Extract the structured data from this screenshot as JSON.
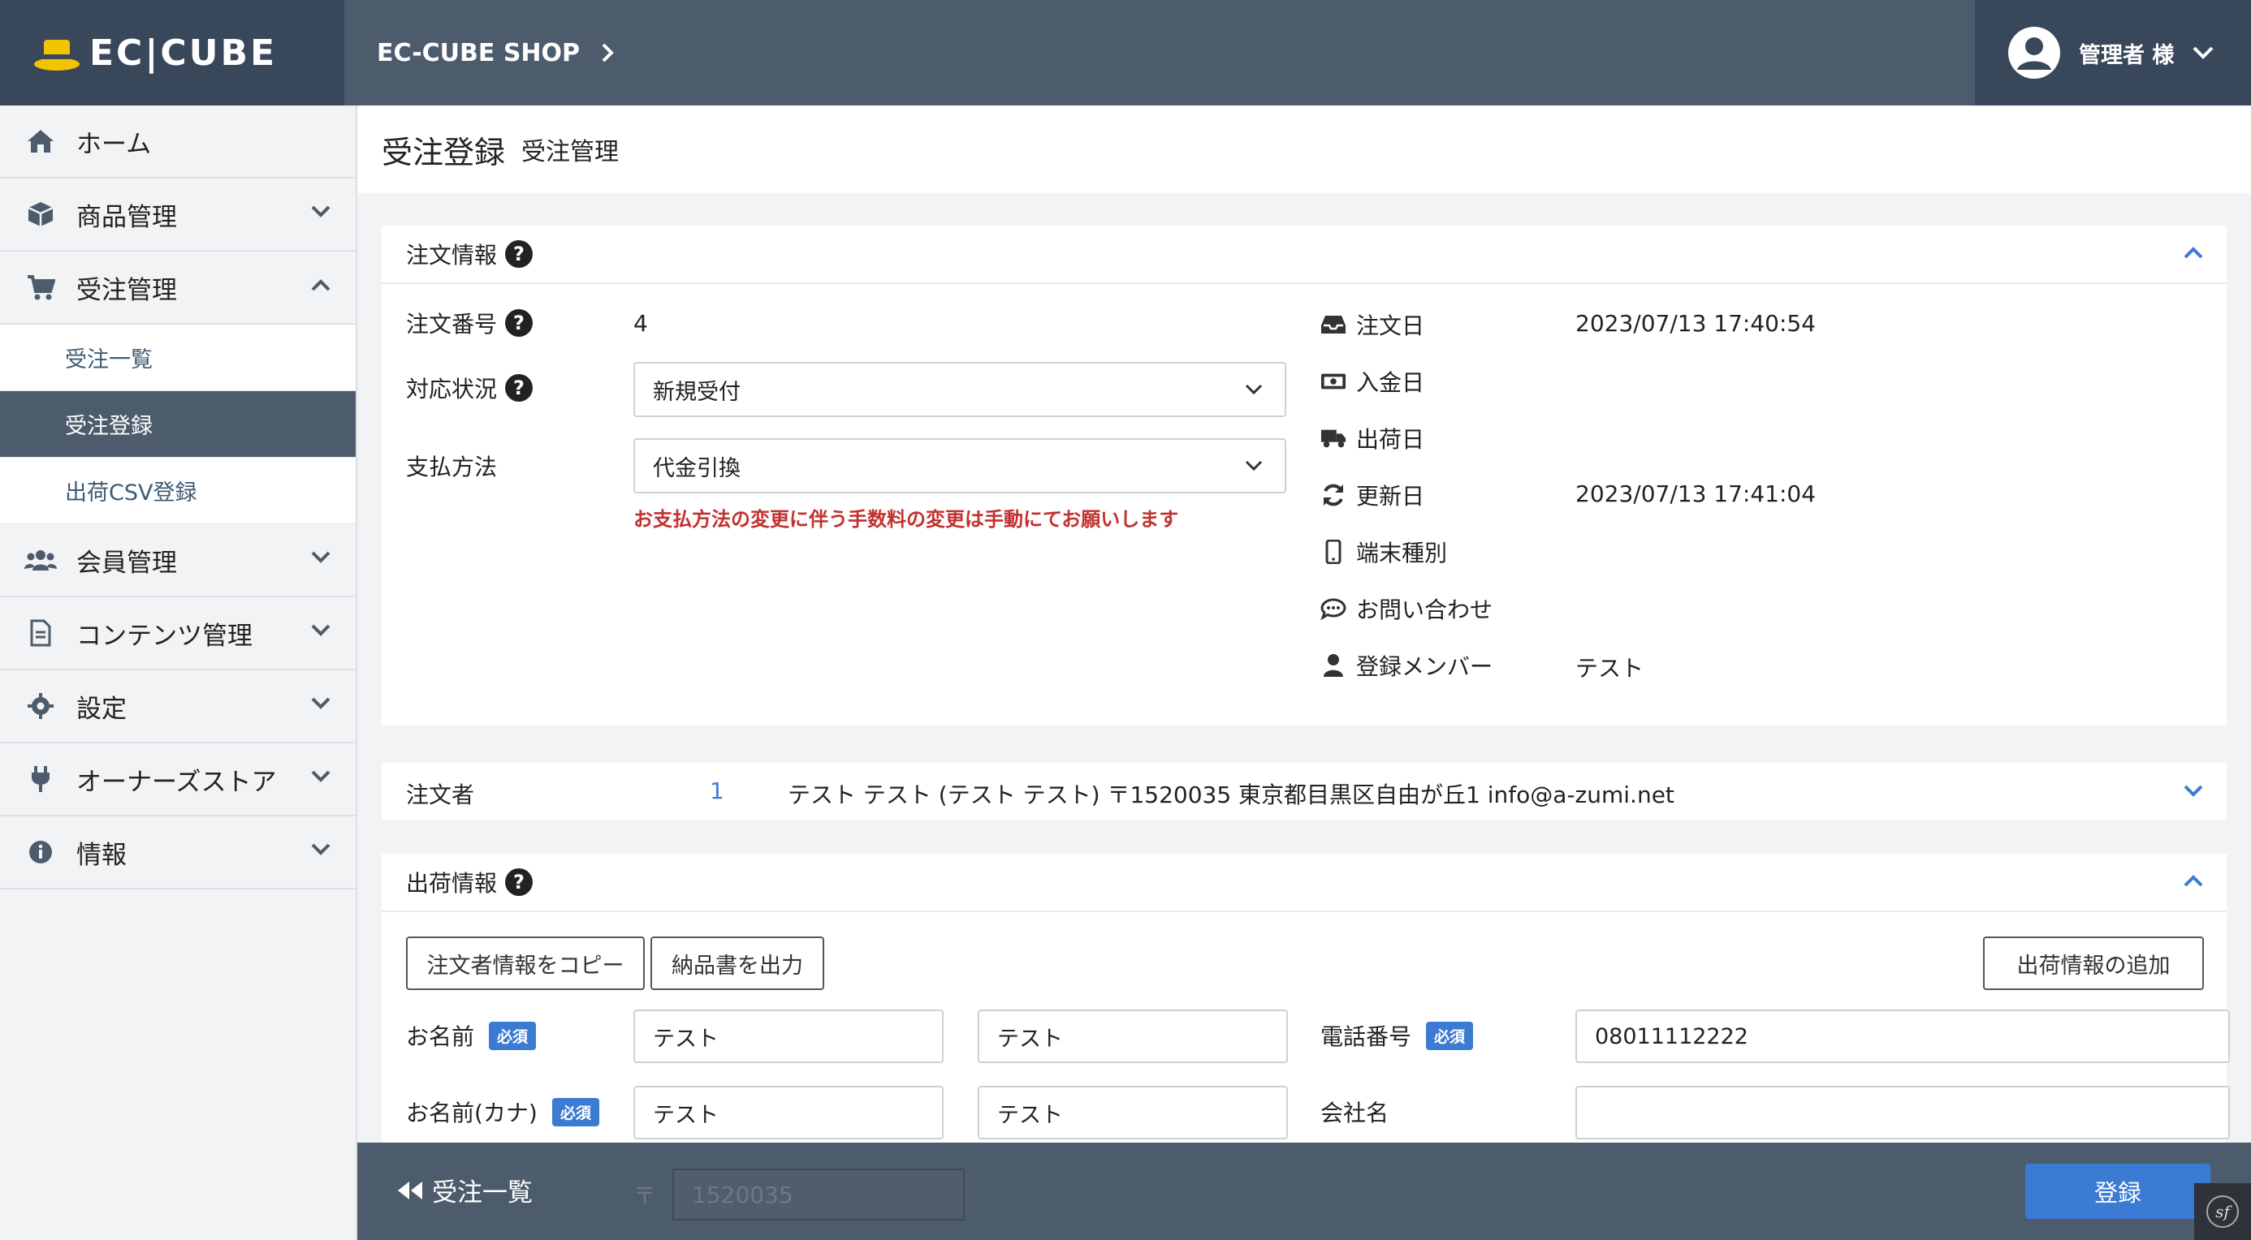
{
  "header": {
    "brand": "EC|CUBE",
    "shop_name": "EC-CUBE SHOP",
    "user_label": "管理者 様"
  },
  "sidebar": {
    "items": [
      {
        "label": "ホーム",
        "icon": "home-icon"
      },
      {
        "label": "商品管理",
        "icon": "box-icon"
      },
      {
        "label": "受注管理",
        "icon": "cart-icon"
      },
      {
        "label": "会員管理",
        "icon": "users-icon"
      },
      {
        "label": "コンテンツ管理",
        "icon": "file-icon"
      },
      {
        "label": "設定",
        "icon": "gear-icon"
      },
      {
        "label": "オーナーズストア",
        "icon": "plug-icon"
      },
      {
        "label": "情報",
        "icon": "info-icon"
      }
    ],
    "sub_items": [
      "受注一覧",
      "受注登録",
      "出荷CSV登録"
    ]
  },
  "page": {
    "title": "受注登録",
    "subtitle": "受注管理"
  },
  "order_info": {
    "heading": "注文情報",
    "order_no_label": "注文番号",
    "order_no": "4",
    "status_label": "対応状況",
    "status_value": "新規受付",
    "payment_label": "支払方法",
    "payment_value": "代金引換",
    "payment_warning": "お支払方法の変更に伴う手数料の変更は手動にてお願いします",
    "order_date_label": "注文日",
    "order_date": "2023/07/13 17:40:54",
    "payment_date_label": "入金日",
    "shipping_date_label": "出荷日",
    "update_date_label": "更新日",
    "update_date": "2023/07/13 17:41:04",
    "device_label": "端末種別",
    "inquiry_label": "お問い合わせ",
    "member_label": "登録メンバー",
    "member_value": "テスト"
  },
  "customer": {
    "label": "注文者",
    "id": "1",
    "summary": "テスト テスト (テスト テスト) 〒1520035 東京都目黒区自由が丘1 info@a-zumi.net"
  },
  "shipping": {
    "heading": "出荷情報",
    "copy_button": "注文者情報をコピー",
    "delivery_note_button": "納品書を出力",
    "add_button": "出荷情報の追加",
    "name_label": "お名前",
    "required": "必須",
    "last_name": "テスト",
    "first_name": "テスト",
    "kana_label": "お名前(カナ)",
    "kana_last": "テスト",
    "kana_first": "テスト",
    "phone_label": "電話番号",
    "phone": "08011112222",
    "company_label": "会社名",
    "company": "",
    "zip_mark": "〒",
    "zip": "1520035"
  },
  "footer": {
    "back_label": "受注一覧",
    "save_label": "登録"
  },
  "colors": {
    "header": "#4d5c6c",
    "brand_bg": "#39475a",
    "accent": "#3b7bd4",
    "warning": "#c2312f"
  }
}
